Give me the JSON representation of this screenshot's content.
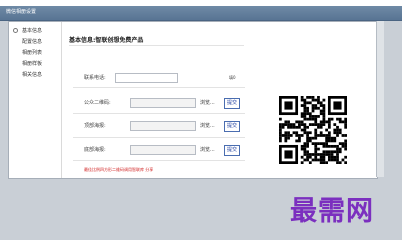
{
  "window": {
    "title": "微信相册设置"
  },
  "sidebar": {
    "items": [
      {
        "label": "基本信息"
      },
      {
        "label": "配置信息"
      },
      {
        "label": "相册列表"
      },
      {
        "label": "相册样板"
      },
      {
        "label": "相关信息"
      }
    ]
  },
  "main": {
    "title": "基本信息:智联创想免费产品",
    "phone": {
      "label": "联系电话:",
      "value": ""
    },
    "side_note": "填0",
    "fields": [
      {
        "label": "公众二维码:",
        "browse": "浏览...",
        "submit": "提交"
      },
      {
        "label": "顶部海报:",
        "browse": "浏览...",
        "submit": "提交"
      },
      {
        "label": "底部海报:",
        "browse": "浏览...",
        "submit": "提交"
      }
    ],
    "note": "最佳比例四方形二维码调用智联库  分享"
  },
  "qr": {
    "description": "qr-code-icon"
  },
  "watermark": "最需网"
}
